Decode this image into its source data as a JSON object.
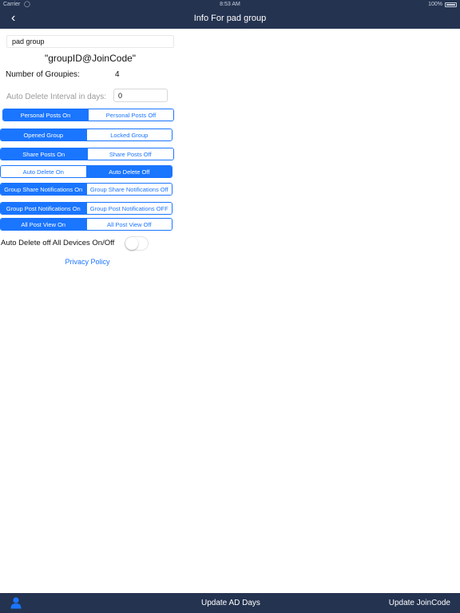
{
  "status_bar": {
    "carrier": "Carrier",
    "time": "8:53 AM",
    "battery": "100%"
  },
  "nav": {
    "back_icon": "chevron-left-icon",
    "title": "Info For pad group"
  },
  "group": {
    "name": "pad group",
    "join_code": "\"groupID@JoinCode\"",
    "count_label": "Number of Groupies:",
    "count_value": "4",
    "auto_delete_label": "Auto Delete Interval in days:",
    "auto_delete_value": "0"
  },
  "segments": [
    {
      "left": "Personal Posts  On",
      "right": "Personal Posts Off",
      "active": 0
    },
    {
      "left": "Opened Group",
      "right": "Locked Group",
      "active": 0
    },
    {
      "left": "Share Posts On",
      "right": "Share Posts Off",
      "active": 0
    },
    {
      "left": "Auto Delete On",
      "right": "Auto Delete Off",
      "active": 1
    },
    {
      "left": "Group Share Notifications On",
      "right": "Group Share Notifications Off",
      "active": 0
    },
    {
      "left": "Group Post Notifications On",
      "right": "Group Post Notifications OFF",
      "active": 0
    },
    {
      "left": "All Post View On",
      "right": "All Post View Off",
      "active": 0
    }
  ],
  "toggle": {
    "label": "Auto Delete off All Devices On/Off",
    "on": false
  },
  "privacy": "Privacy Policy",
  "tab_bar": {
    "user_icon": "user-icon",
    "update_ad": "Update AD Days",
    "update_join": "Update JoinCode"
  },
  "colors": {
    "bar": "#243350",
    "accent": "#1a75ff"
  }
}
